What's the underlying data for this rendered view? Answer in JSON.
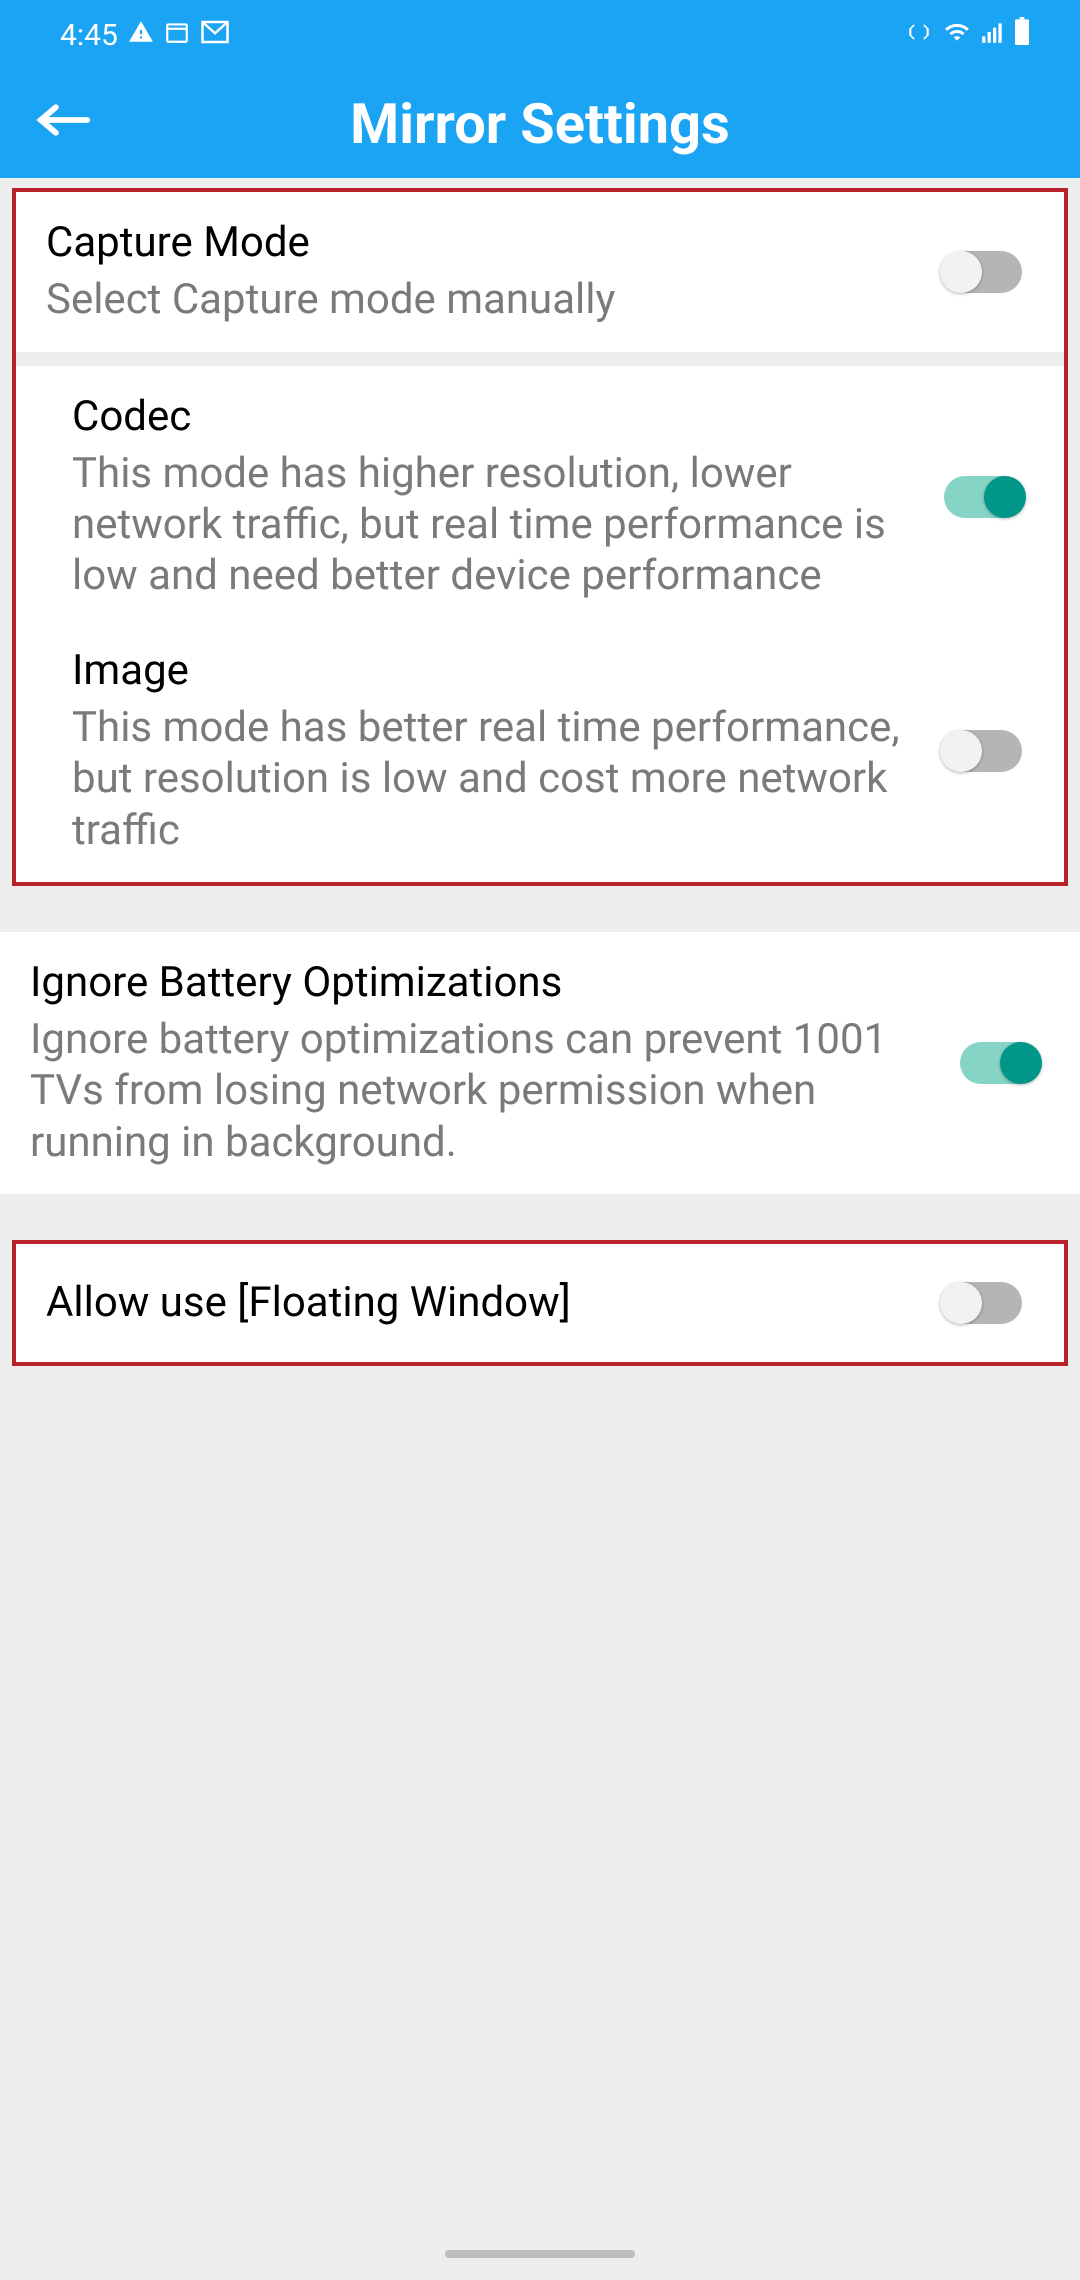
{
  "status": {
    "time": "4:45",
    "icons_left": [
      "warning-icon",
      "calendar-icon",
      "gmail-icon"
    ],
    "icons_right": [
      "vibrate-icon",
      "wifi-icon",
      "signal-icon",
      "battery-icon"
    ]
  },
  "header": {
    "title": "Mirror Settings"
  },
  "settings": {
    "capture_mode": {
      "title": "Capture Mode",
      "desc": "Select Capture mode manually",
      "value": false
    },
    "codec": {
      "title": "Codec",
      "desc": "This mode has higher resolution, lower network traffic, but real time performance is low and need better device performance",
      "value": true
    },
    "image": {
      "title": "Image",
      "desc": "This mode has better real time performance, but resolution is low and cost more network traffic",
      "value": false
    },
    "battery": {
      "title": "Ignore Battery Optimizations",
      "desc": "Ignore battery optimizations can prevent 1001 TVs from losing network permission when running in background.",
      "value": true
    },
    "floating": {
      "title": "Allow use [Floating Window]",
      "value": false
    }
  }
}
